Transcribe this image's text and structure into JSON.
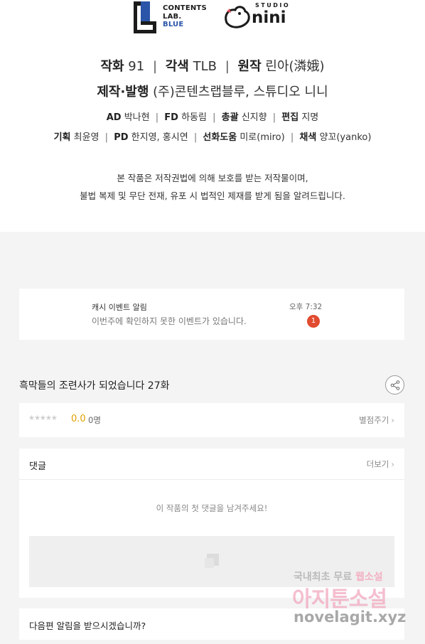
{
  "logos": {
    "contents_lab_lines": [
      "CONTENTS",
      "LAB.",
      "BLUE"
    ],
    "studio_label": "STUDIO",
    "studio_name": "nini"
  },
  "credits": {
    "line1": [
      {
        "label": "작화",
        "value": "91"
      },
      {
        "label": "각색",
        "value": "TLB"
      },
      {
        "label": "원작",
        "value": "린아(潾娥)"
      }
    ],
    "line2": {
      "label": "제작·발행",
      "value": "(주)콘텐츠랩블루, 스튜디오 니니"
    },
    "line3": [
      {
        "label": "AD",
        "value": "박나현"
      },
      {
        "label": "FD",
        "value": "하동림"
      },
      {
        "label": "총괄",
        "value": "신지향"
      },
      {
        "label": "편집",
        "value": "지명"
      }
    ],
    "line4": [
      {
        "label": "기획",
        "value": "최윤영"
      },
      {
        "label": "PD",
        "value": "한지영, 홍시연"
      },
      {
        "label": "선화도움",
        "value": "미로(miro)"
      },
      {
        "label": "채색",
        "value": "양꼬(yanko)"
      }
    ],
    "separator": "|"
  },
  "notice": {
    "line1": "본 작품은 저작권법에 의해 보호를 받는 저작물이며,",
    "line2": "불법 복제 및 무단 전재, 유포 시 법적인 제재를 받게 됨을 알려드립니다."
  },
  "alert": {
    "title": "캐시 이벤트 알림",
    "message": "이번주에 확인하지 못한 이벤트가 있습니다.",
    "time": "오후 7:32",
    "badge_count": "1"
  },
  "episode": {
    "title": "흑막들의 조련사가 되었습니다 27화"
  },
  "rating": {
    "stars": "★★★★★",
    "score": "0.0",
    "raters": "0명",
    "rate_button": "별점주기"
  },
  "comments": {
    "title": "댓글",
    "more_button": "더보기",
    "empty_message": "이 작품의 첫 댓글을 남겨주세요!"
  },
  "notify": {
    "label": "다음편 알림을 받으시겠습니까?"
  },
  "watermark": {
    "line1_gray": "국내최초 무료",
    "line1_pink": "웹소설",
    "line2": "아지툰소설",
    "line3": "novelagit.xyz"
  },
  "chevron": "›",
  "colors": {
    "score": "#e0a100",
    "badge": "#e14b2f",
    "brand_blue": "#2a55a8",
    "page_bg": "#f4f4f5"
  }
}
